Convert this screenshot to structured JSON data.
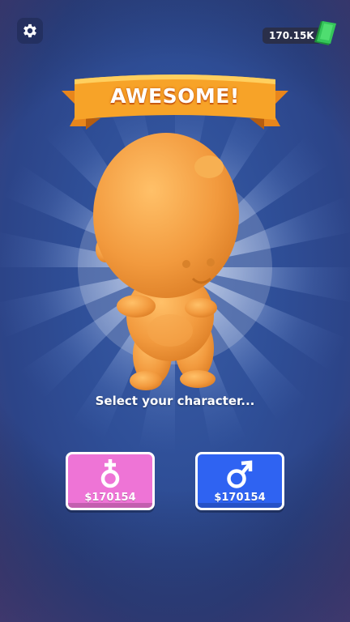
{
  "banner": {
    "text": "AWESOME!"
  },
  "currency": {
    "amount": "170.15K",
    "icon": "cash-icon"
  },
  "settings": {
    "icon": "gear-icon"
  },
  "prompt": {
    "text": "Select your character..."
  },
  "options": [
    {
      "gender": "female",
      "icon": "female-symbol-icon",
      "price": "$170154",
      "color": "#ee74d6"
    },
    {
      "gender": "male",
      "icon": "male-symbol-icon",
      "price": "$170154",
      "color": "#2f63f2"
    }
  ],
  "colors": {
    "background": "#2f4f98",
    "banner": "#f7a328",
    "character": "#f0a04a"
  }
}
